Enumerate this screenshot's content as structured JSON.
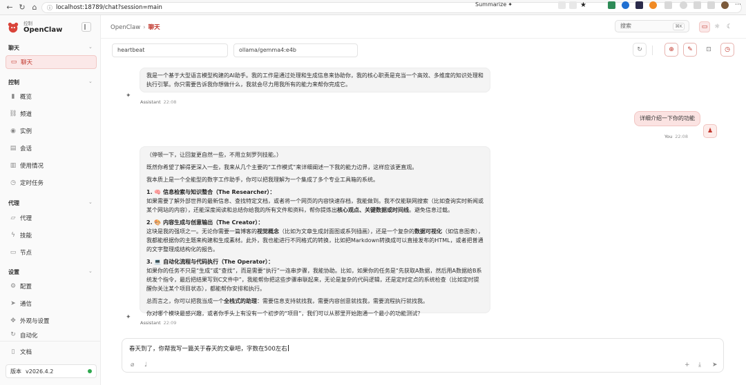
{
  "browser": {
    "url": "localhost:18789/chat?session=main",
    "summarize_label": "Summarize"
  },
  "sidebar": {
    "brand_small": "控制",
    "brand_name": "OpenClaw",
    "sections": {
      "chat": "聊天",
      "control": "控制",
      "agent": "代理",
      "settings": "设置"
    },
    "items": {
      "chat": "聊天",
      "overview": "概览",
      "channels": "频道",
      "instances": "实例",
      "sessions": "会话",
      "usage": "使用情况",
      "cron": "定时任务",
      "agents": "代理",
      "skills": "技能",
      "nodes": "节点",
      "config": "配置",
      "comms": "通信",
      "appearance": "外观与设置",
      "automation": "自动化",
      "docs": "文档"
    },
    "version_label": "版本",
    "version_value": "v2026.4.2"
  },
  "topbar": {
    "crumb_root": "OpenClaw",
    "crumb_sep": "›",
    "crumb_current": "聊天",
    "search_placeholder": "搜索",
    "search_kbd": "⌘K"
  },
  "controls": {
    "session": "heartbeat",
    "model": "ollama/gemma4:e4b"
  },
  "messages": {
    "intro": "我是一个基于大型语言模型构建的AI助手。我的工作是通过处理和生成信息来协助你，我的核心职责是充当一个高效、多维度的知识处理和执行引擎。你只需要告诉我你想做什么，我就会尽力用我所有的能力来帮你完成它。",
    "assistant_label": "Assistant",
    "time1": "22:08",
    "user_text": "详细介绍一下你的功能",
    "you_label": "You",
    "time2": "22:08",
    "p1": "（停顿一下，让回复更自然一些，不用立刻罗列技能。）",
    "p2": "既然你希望了解得更深入一些，我来从几个主要的“工作模式”来详细阐述一下我的能力边界，这样应该更直观。",
    "p3": "我本质上是一个全能型的数字工作助手，你可以把我理解为一个集成了多个专业工具箱的系统。",
    "h1": "1. 🧠 信息检索与知识整合（The Researcher）：",
    "b1a": "如果需要了解外部世界的最新信息、查找特定文档，或者将一个网页的内容快速存档，我能做到。我不仅能联网搜索（比如查询实时新闻或某个网站的内容），还能深度阅读和总结你给我的所有文件和资料，帮你提炼出",
    "b1b": "核心观点、关键数据或时间线",
    "b1c": "。避免信息过载。",
    "h2": "2. 🎨 内容生成与创意输出（The Creator）：",
    "b2a": "这块是我的强项之一。无论你需要一篇博客的",
    "b2b": "视觉概念",
    "b2c": "（比如为文章生成封面图或系列插画），还是一个复杂的",
    "b2d": "数据可视化",
    "b2e": "（如信息图表），我都能根据你的主题来构建和生成素材。此外，我也能进行不同格式的转换，比如把Markdown转换成可以直接发布的HTML，或者把普通的文字整理成结构化的报告。",
    "h3": "3. 💻 自动化流程与代码执行（The Operator）：",
    "b3": "如果你的任务不只是“生成”或“查找”，而是需要“执行”一连串步骤，我能协助。比如，如果你的任务是“先获取A数据，然后用A数据给B系统发个指令，最后把结果写到C文件中”，我能帮你把这些步骤串联起来，无论是复杂的代码逻辑，还是定时定点的系统检查（比如定时提醒你关注某个项目状态），都能帮你安排和执行。",
    "s_a": "总而言之，你可以把我当成一个",
    "s_b": "全栈式的助理",
    "s_c": "：需要信息支持就找我，需要内容创意就找我，需要流程执行就找我。",
    "closing": "你对哪个模块最感兴趣，或者你手头上有没有一个初步的“项目”，我们可以从那里开始跑通一个最小的功能测试？",
    "time3": "22:09"
  },
  "composer": {
    "text": "春天到了，你帮我写一篇关于春天的文章吧，字数在500左右"
  },
  "colors": {
    "accent": "#c0362c",
    "accent_bg": "#fbe8e8",
    "status_ok": "#2fa84f"
  }
}
